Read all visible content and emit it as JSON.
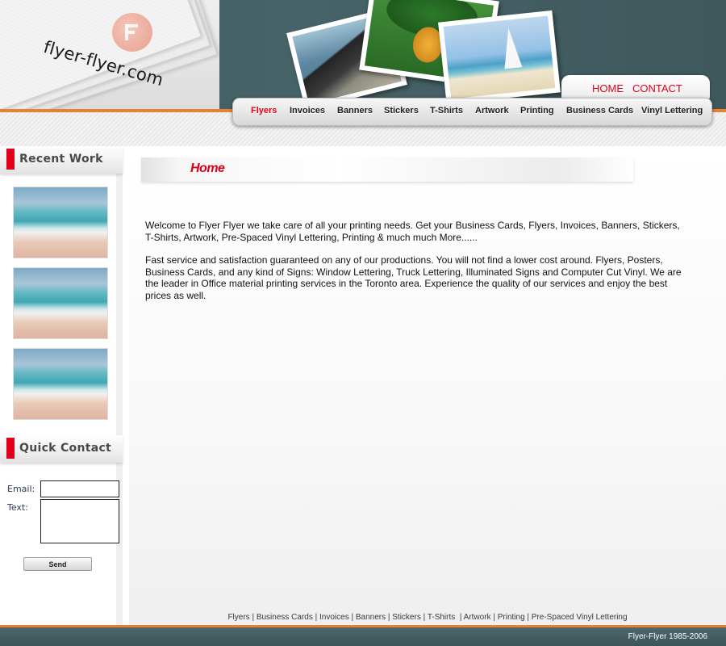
{
  "header": {
    "logo_text": "flyer-flyer.com",
    "top_links": {
      "home": "HOME",
      "contact": "CONTACT"
    },
    "photos": [
      "coast-photo",
      "pineapple-photo",
      "sailboat-photo"
    ]
  },
  "nav": {
    "items": [
      {
        "label": "Flyers",
        "active": true
      },
      {
        "label": "Invoices"
      },
      {
        "label": "Banners"
      },
      {
        "label": "Stickers"
      },
      {
        "label": "T-Shirts"
      },
      {
        "label": "Artwork"
      },
      {
        "label": "Printing"
      },
      {
        "label": "Business Cards"
      },
      {
        "label": "Vinyl Lettering"
      }
    ]
  },
  "sidebar": {
    "recent_work_title": "Recent Work",
    "quick_contact_title": "Quick Contact",
    "email_label": "Email:",
    "text_label": "Text:",
    "email_value": "",
    "text_value": "",
    "send_label": "Send"
  },
  "main": {
    "page_title": "Home",
    "paragraph_1": "Welcome to Flyer Flyer we take care of all your printing needs. Get your Business Cards, Flyers, Invoices, Banners, Stickers, T-Shirts, Artwork, Pre-Spaced Vinyl Lettering, Printing & much much More......",
    "paragraph_2": "Fast service and satisfaction guaranteed on any of our productions. You will not find a lower cost around. Flyers, Posters, Business Cards, and any kind of Signs: Window Lettering, Truck Lettering, Illuminated Signs and Computer Cut Vinyl. We are the leader in Office material printing services in the Toronto area. Experience the quality of our services and enjoy the best prices as well."
  },
  "footer": {
    "links": [
      "Flyers",
      "Business Cards",
      "Invoices",
      "Banners",
      "Stickers",
      "T-Shirts",
      "Artwork",
      "Printing",
      "Pre-Spaced Vinyl Lettering"
    ],
    "copyright": "Flyer-Flyer 1985-2006"
  },
  "colors": {
    "accent_red": "#e2001a",
    "header_teal": "#466468",
    "accent_orange": "#e9822d"
  }
}
